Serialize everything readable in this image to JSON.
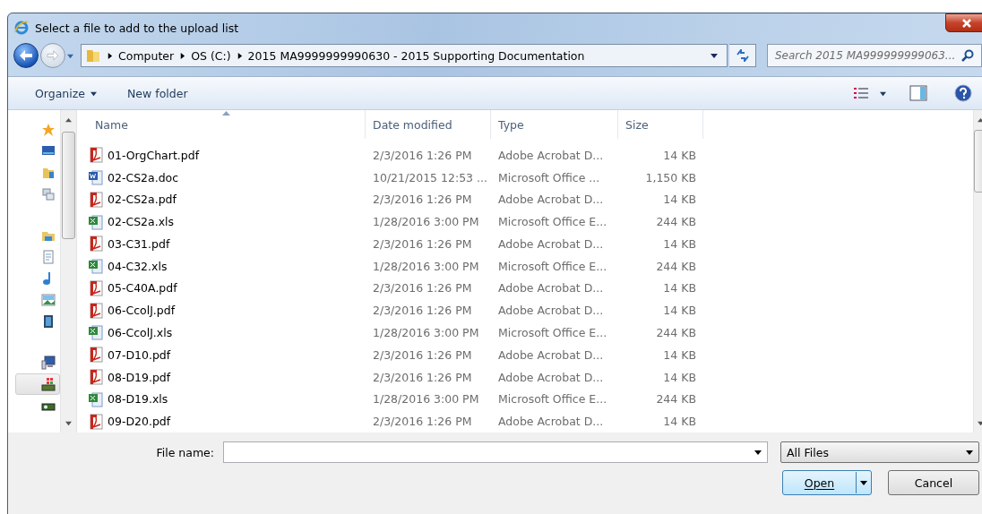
{
  "window": {
    "title": "Select a file to add to the upload list"
  },
  "address": {
    "crumbs": [
      "Computer",
      "OS (C:)",
      "2015 MA9999999990630 - 2015 Supporting Documentation"
    ]
  },
  "search": {
    "placeholder": "Search 2015 MA999999999063..."
  },
  "toolbar": {
    "buttons": [
      {
        "label": "Organize",
        "dropdown": true
      },
      {
        "label": "New folder",
        "dropdown": false
      }
    ]
  },
  "nav_pane": [
    {
      "kind": "star",
      "selected": false
    },
    {
      "kind": "desktop",
      "selected": false
    },
    {
      "kind": "folder",
      "selected": false
    },
    {
      "kind": "recent",
      "selected": false
    },
    {
      "kind": "gap",
      "selected": false
    },
    {
      "kind": "library",
      "selected": false
    },
    {
      "kind": "document",
      "selected": false
    },
    {
      "kind": "music",
      "selected": false
    },
    {
      "kind": "image",
      "selected": false
    },
    {
      "kind": "video",
      "selected": false
    },
    {
      "kind": "gap",
      "selected": false
    },
    {
      "kind": "computer",
      "selected": false
    },
    {
      "kind": "drive",
      "selected": true
    },
    {
      "kind": "key",
      "selected": false
    }
  ],
  "table": {
    "columns": [
      "Name",
      "Date modified",
      "Type",
      "Size"
    ],
    "rows": [
      {
        "kind": "pdf",
        "name": "01-OrgChart.pdf",
        "date": "2/3/2016 1:26 PM",
        "type": "Adobe Acrobat D...",
        "size": "14 KB"
      },
      {
        "kind": "doc",
        "name": "02-CS2a.doc",
        "date": "10/21/2015 12:53 ...",
        "type": "Microsoft Office ...",
        "size": "1,150 KB"
      },
      {
        "kind": "pdf",
        "name": "02-CS2a.pdf",
        "date": "2/3/2016 1:26 PM",
        "type": "Adobe Acrobat D...",
        "size": "14 KB"
      },
      {
        "kind": "xls",
        "name": "02-CS2a.xls",
        "date": "1/28/2016 3:00 PM",
        "type": "Microsoft Office E...",
        "size": "244 KB"
      },
      {
        "kind": "pdf",
        "name": "03-C31.pdf",
        "date": "2/3/2016 1:26 PM",
        "type": "Adobe Acrobat D...",
        "size": "14 KB"
      },
      {
        "kind": "xls",
        "name": "04-C32.xls",
        "date": "1/28/2016 3:00 PM",
        "type": "Microsoft Office E...",
        "size": "244 KB"
      },
      {
        "kind": "pdf",
        "name": "05-C40A.pdf",
        "date": "2/3/2016 1:26 PM",
        "type": "Adobe Acrobat D...",
        "size": "14 KB"
      },
      {
        "kind": "pdf",
        "name": "06-CcolJ.pdf",
        "date": "2/3/2016 1:26 PM",
        "type": "Adobe Acrobat D...",
        "size": "14 KB"
      },
      {
        "kind": "xls",
        "name": "06-CcolJ.xls",
        "date": "1/28/2016 3:00 PM",
        "type": "Microsoft Office E...",
        "size": "244 KB"
      },
      {
        "kind": "pdf",
        "name": "07-D10.pdf",
        "date": "2/3/2016 1:26 PM",
        "type": "Adobe Acrobat D...",
        "size": "14 KB"
      },
      {
        "kind": "pdf",
        "name": "08-D19.pdf",
        "date": "2/3/2016 1:26 PM",
        "type": "Adobe Acrobat D...",
        "size": "14 KB"
      },
      {
        "kind": "xls",
        "name": "08-D19.xls",
        "date": "1/28/2016 3:00 PM",
        "type": "Microsoft Office E...",
        "size": "244 KB"
      },
      {
        "kind": "pdf",
        "name": "09-D20.pdf",
        "date": "2/3/2016 1:26 PM",
        "type": "Adobe Acrobat D...",
        "size": "14 KB"
      }
    ]
  },
  "file_name": {
    "label": "File name:"
  },
  "file_type": {
    "value": "All Files"
  },
  "buttons": [
    {
      "label": "Open",
      "kind": "split"
    },
    {
      "label": "Cancel",
      "kind": "plain"
    }
  ]
}
